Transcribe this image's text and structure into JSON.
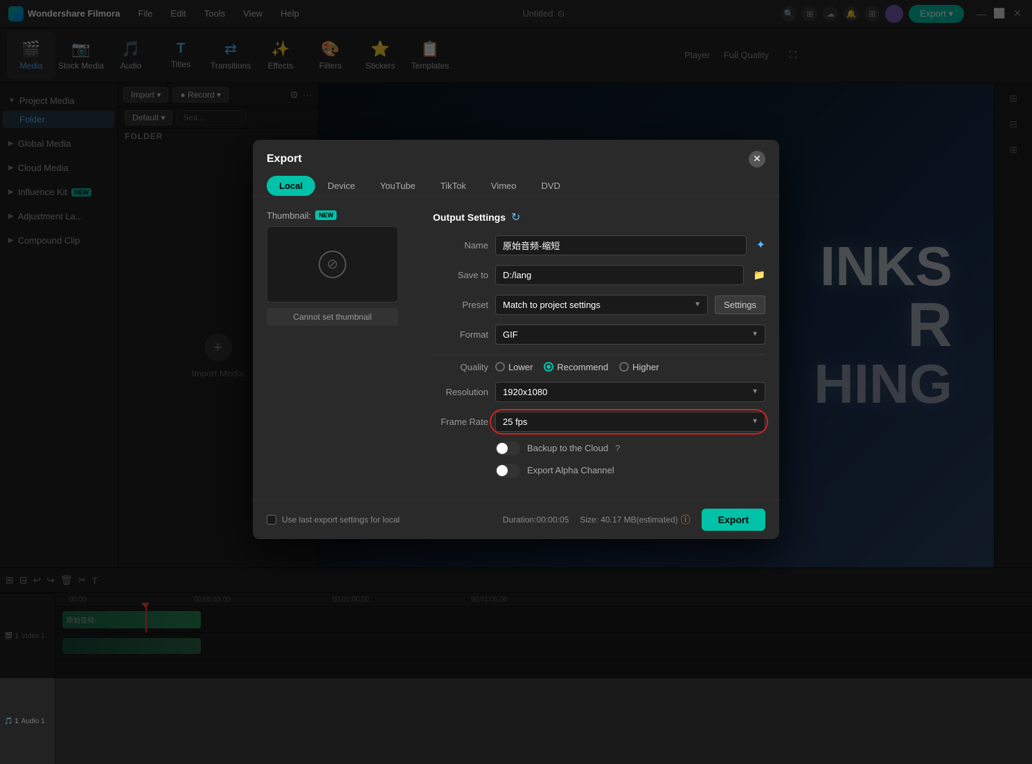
{
  "app": {
    "name": "Wondershare Filmora",
    "title": "Untitled",
    "logo_bg": "#00c2a8"
  },
  "menubar": {
    "items": [
      "File",
      "Edit",
      "Tools",
      "View",
      "Help"
    ],
    "export_label": "Export ▾",
    "window_controls": [
      "—",
      "⬜",
      "✕"
    ]
  },
  "toolbar": {
    "items": [
      {
        "id": "media",
        "icon": "🎬",
        "label": "Media",
        "active": true
      },
      {
        "id": "stock",
        "icon": "📷",
        "label": "Stock Media"
      },
      {
        "id": "audio",
        "icon": "🎵",
        "label": "Audio"
      },
      {
        "id": "titles",
        "icon": "T",
        "label": "Titles"
      },
      {
        "id": "transitions",
        "icon": "⇄",
        "label": "Transitions"
      },
      {
        "id": "effects",
        "icon": "✨",
        "label": "Effects"
      },
      {
        "id": "filters",
        "icon": "🎨",
        "label": "Filters"
      },
      {
        "id": "stickers",
        "icon": "⭐",
        "label": "Stickers"
      },
      {
        "id": "templates",
        "icon": "📋",
        "label": "Templates"
      }
    ],
    "player_label": "Player",
    "quality_label": "Full Quality"
  },
  "sidebar": {
    "sections": [
      {
        "id": "project-media",
        "label": "Project Media",
        "items": [
          {
            "id": "folder",
            "label": "Folder",
            "active": true
          }
        ]
      },
      {
        "id": "global-media",
        "label": "Global Media",
        "items": []
      },
      {
        "id": "cloud-media",
        "label": "Cloud Media",
        "items": []
      },
      {
        "id": "influence-kit",
        "label": "Influence Kit",
        "badge": "NEW",
        "items": []
      },
      {
        "id": "adjustment-la",
        "label": "Adjustment La...",
        "items": []
      },
      {
        "id": "compound-clip",
        "label": "Compound Clip",
        "items": []
      }
    ]
  },
  "media_panel": {
    "import_label": "Import ▾",
    "record_label": "● Record ▾",
    "folder_header": "FOLDER",
    "import_media_label": "Import Media"
  },
  "preview": {
    "text_lines": [
      "INKS",
      "R",
      "HING"
    ]
  },
  "timeline": {
    "tracks": [
      {
        "type": "video",
        "label": "Video 1",
        "num": 1
      },
      {
        "type": "audio",
        "label": "Audio 1",
        "num": 1
      }
    ],
    "times": [
      "00:00",
      "00:00:55:00",
      "00:01:00:00",
      "00:01:05:00"
    ]
  },
  "export_modal": {
    "title": "Export",
    "close_icon": "✕",
    "tabs": [
      {
        "id": "local",
        "label": "Local",
        "active": true
      },
      {
        "id": "device",
        "label": "Device"
      },
      {
        "id": "youtube",
        "label": "YouTube"
      },
      {
        "id": "tiktok",
        "label": "TikTok"
      },
      {
        "id": "vimeo",
        "label": "Vimeo"
      },
      {
        "id": "dvd",
        "label": "DVD"
      }
    ],
    "thumbnail": {
      "label": "Thumbnail:",
      "badge": "NEW",
      "cannot_set_label": "Cannot set thumbnail"
    },
    "output": {
      "title": "Output Settings",
      "refresh_icon": "↻",
      "fields": {
        "name_label": "Name",
        "name_value": "原始音频-缩短",
        "ai_icon": "✦",
        "save_to_label": "Save to",
        "save_to_value": "D:/lang",
        "folder_icon": "📁",
        "preset_label": "Preset",
        "preset_value": "Match to project settings",
        "settings_label": "Settings",
        "format_label": "Format",
        "format_value": "GIF",
        "quality_label": "Quality",
        "quality_options": [
          "Lower",
          "Recommend",
          "Higher"
        ],
        "quality_selected": "Recommend",
        "resolution_label": "Resolution",
        "resolution_value": "1920x1080",
        "frame_rate_label": "Frame Rate",
        "frame_rate_value": "25 fps",
        "backup_label": "Backup to the Cloud",
        "backup_help": "?",
        "alpha_label": "Export Alpha Channel"
      }
    },
    "footer": {
      "use_last_label": "Use last export settings for local",
      "duration_label": "Duration:00:00:05",
      "size_label": "Size: 40.17 MB(estimated)",
      "size_icon": "ⓘ",
      "export_label": "Export"
    }
  }
}
